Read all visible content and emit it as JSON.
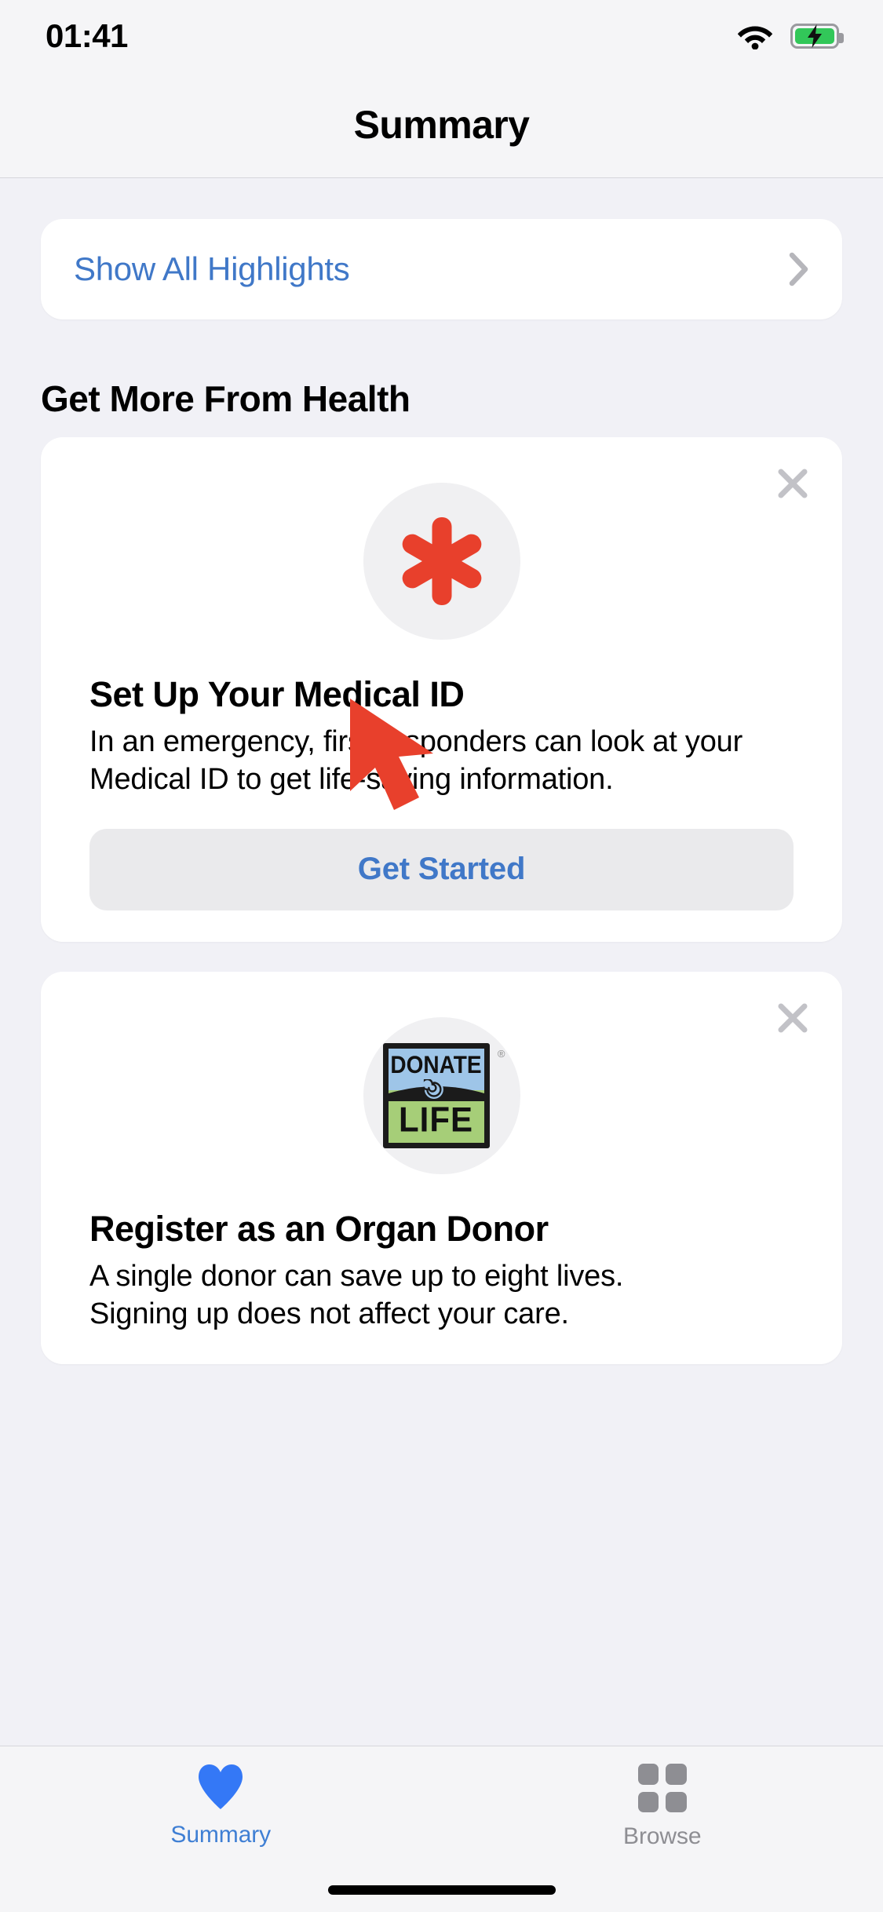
{
  "status_bar": {
    "time": "01:41",
    "wifi_icon": "wifi-icon",
    "battery_icon": "battery-charging-icon",
    "battery_color": "#32C759"
  },
  "nav": {
    "title": "Summary"
  },
  "highlights": {
    "label": "Show All Highlights",
    "chevron_icon": "chevron-right-icon",
    "accent_color": "#4078c8"
  },
  "section": {
    "heading": "Get More From Health"
  },
  "promos": [
    {
      "icon": "medical-id-asterisk-icon",
      "icon_color": "#E8402C",
      "title": "Set Up Your Medical ID",
      "description": "In an emergency, first responders can look at your Medical ID to get life-saving information.",
      "cta_label": "Get Started",
      "close_icon": "close-icon"
    },
    {
      "icon": "donate-life-logo",
      "logo_top_text": "DONATE",
      "logo_bottom_text": "LIFE",
      "logo_trademark": "®",
      "logo_top_color": "#9ec5e8",
      "logo_bottom_color": "#a6ce78",
      "title": "Register as an Organ Donor",
      "description_line1": "A single donor can save up to eight lives.",
      "description_line2": "Signing up does not affect your care.",
      "close_icon": "close-icon"
    }
  ],
  "tabbar": {
    "tabs": [
      {
        "label": "Summary",
        "icon": "heart-icon",
        "active": true,
        "color": "#3f7fd4"
      },
      {
        "label": "Browse",
        "icon": "grid-icon",
        "active": false,
        "color": "#8e8e93"
      }
    ]
  },
  "cursor": {
    "icon": "mouse-pointer-arrow",
    "color": "#E8402C"
  }
}
